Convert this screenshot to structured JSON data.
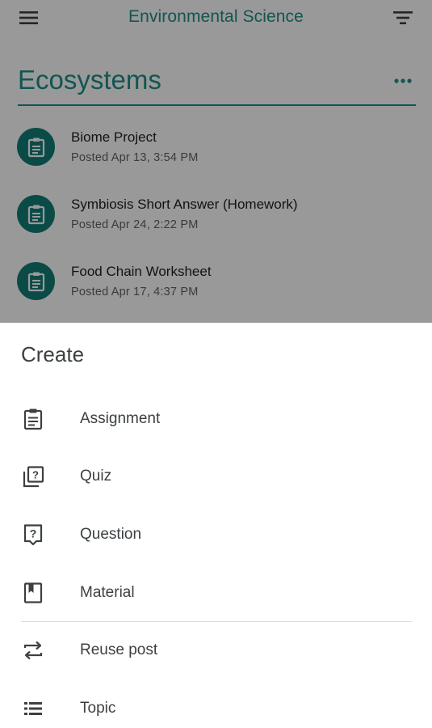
{
  "app_bar": {
    "title": "Environmental Science",
    "menu_icon": "hamburger-menu-icon",
    "filter_icon": "filter-icon"
  },
  "topic": {
    "title": "Ecosystems",
    "more_icon": "more-horizontal-icon"
  },
  "posts": [
    {
      "title": "Biome Project",
      "date": "Posted Apr 13, 3:54 PM",
      "icon": "assignment-icon"
    },
    {
      "title": "Symbiosis Short Answer (Homework)",
      "date": "Posted Apr 24, 2:22 PM",
      "icon": "assignment-icon"
    },
    {
      "title": "Food Chain Worksheet",
      "date": "Posted Apr 17, 4:37 PM",
      "icon": "assignment-icon"
    }
  ],
  "create_sheet": {
    "title": "Create",
    "items": [
      {
        "label": "Assignment",
        "icon": "assignment-icon"
      },
      {
        "label": "Quiz",
        "icon": "quiz-icon"
      },
      {
        "label": "Question",
        "icon": "question-icon"
      },
      {
        "label": "Material",
        "icon": "material-icon"
      },
      {
        "label": "Reuse post",
        "icon": "reuse-icon"
      },
      {
        "label": "Topic",
        "icon": "topic-icon"
      }
    ]
  },
  "colors": {
    "accent": "#1e8e87",
    "avatar": "#127e78",
    "scrim": "rgba(0,0,0,0.40)",
    "text_primary": "#202124",
    "text_secondary": "#5f6368"
  }
}
